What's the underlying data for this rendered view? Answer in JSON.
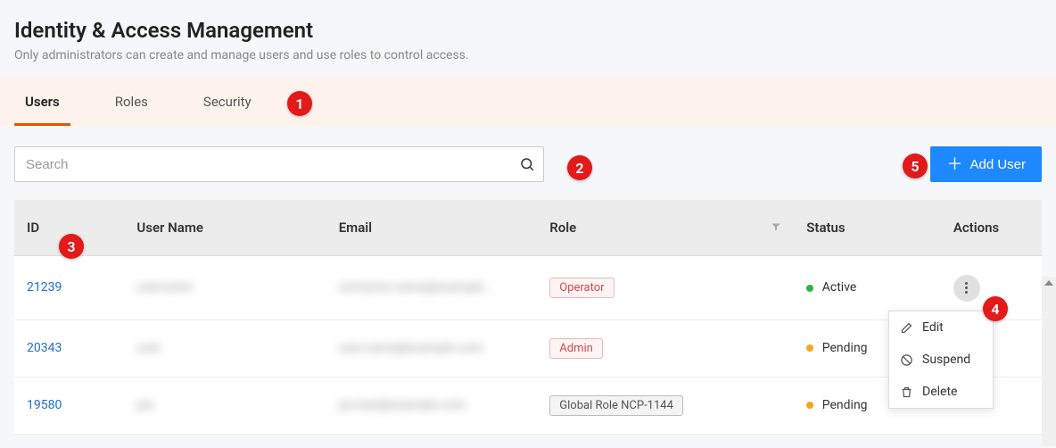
{
  "header": {
    "title": "Identity & Access Management",
    "subtitle": "Only administrators can create and manage users and use roles to control access."
  },
  "tabs": [
    {
      "label": "Users",
      "active": true
    },
    {
      "label": "Roles",
      "active": false
    },
    {
      "label": "Security",
      "active": false
    }
  ],
  "search": {
    "placeholder": "Search",
    "value": ""
  },
  "add_user_button": {
    "label": "Add User"
  },
  "table": {
    "columns": {
      "id": "ID",
      "user_name": "User Name",
      "email": "Email",
      "role": "Role",
      "status": "Status",
      "actions": "Actions"
    },
    "rows": [
      {
        "id": "21239",
        "user_name": "(redacted)",
        "email": "(redacted)",
        "role": {
          "label": "Operator",
          "variant": "operator"
        },
        "status": {
          "label": "Active",
          "state": "active"
        }
      },
      {
        "id": "20343",
        "user_name": "(redacted)",
        "email": "(redacted)",
        "role": {
          "label": "Admin",
          "variant": "admin"
        },
        "status": {
          "label": "Pending",
          "state": "pending"
        }
      },
      {
        "id": "19580",
        "user_name": "(redacted)",
        "email": "(redacted)",
        "role": {
          "label": "Global Role NCP-1144",
          "variant": "global"
        },
        "status": {
          "label": "Pending",
          "state": "pending"
        }
      }
    ]
  },
  "row_actions_menu": {
    "items": [
      {
        "label": "Edit",
        "icon": "edit-icon"
      },
      {
        "label": "Suspend",
        "icon": "suspend-icon"
      },
      {
        "label": "Delete",
        "icon": "delete-icon"
      }
    ]
  },
  "annotations": [
    "1",
    "2",
    "3",
    "4",
    "5"
  ]
}
